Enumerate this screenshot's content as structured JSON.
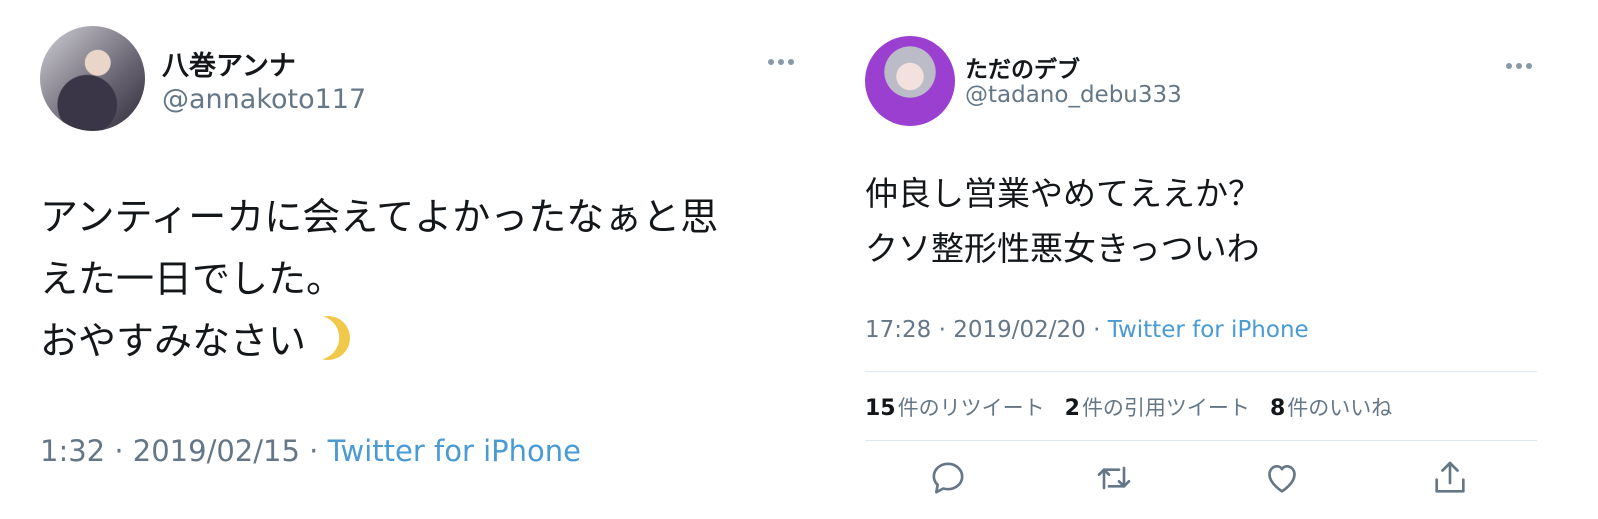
{
  "tweet1": {
    "display_name": "八巻アンナ",
    "handle": "@annakoto117",
    "text": "アンティーカに会えてよかったなぁと思\nえた一日でした。\nおやすみなさい",
    "emoji": "crescent-moon-icon",
    "time_date": "1:32 · 2019/02/15 · ",
    "source": "Twitter for iPhone"
  },
  "tweet2": {
    "display_name": "ただのデブ",
    "handle": "@tadano_debu333",
    "text": "仲良し営業やめてええか？\nクソ整形性悪女きっついわ",
    "time_date": "17:28 · 2019/02/20 · ",
    "source": "Twitter for iPhone",
    "stats": {
      "retweets_count": "15",
      "retweets_label": "件のリツイート",
      "quotes_count": "2",
      "quotes_label": "件の引用ツイート",
      "likes_count": "8",
      "likes_label": "件のいいね"
    },
    "actions": [
      "reply-icon",
      "retweet-icon",
      "like-icon",
      "share-icon"
    ]
  },
  "colors": {
    "link": "#4a9ad4",
    "secondary": "#657786",
    "divider": "#e1e8ed"
  }
}
